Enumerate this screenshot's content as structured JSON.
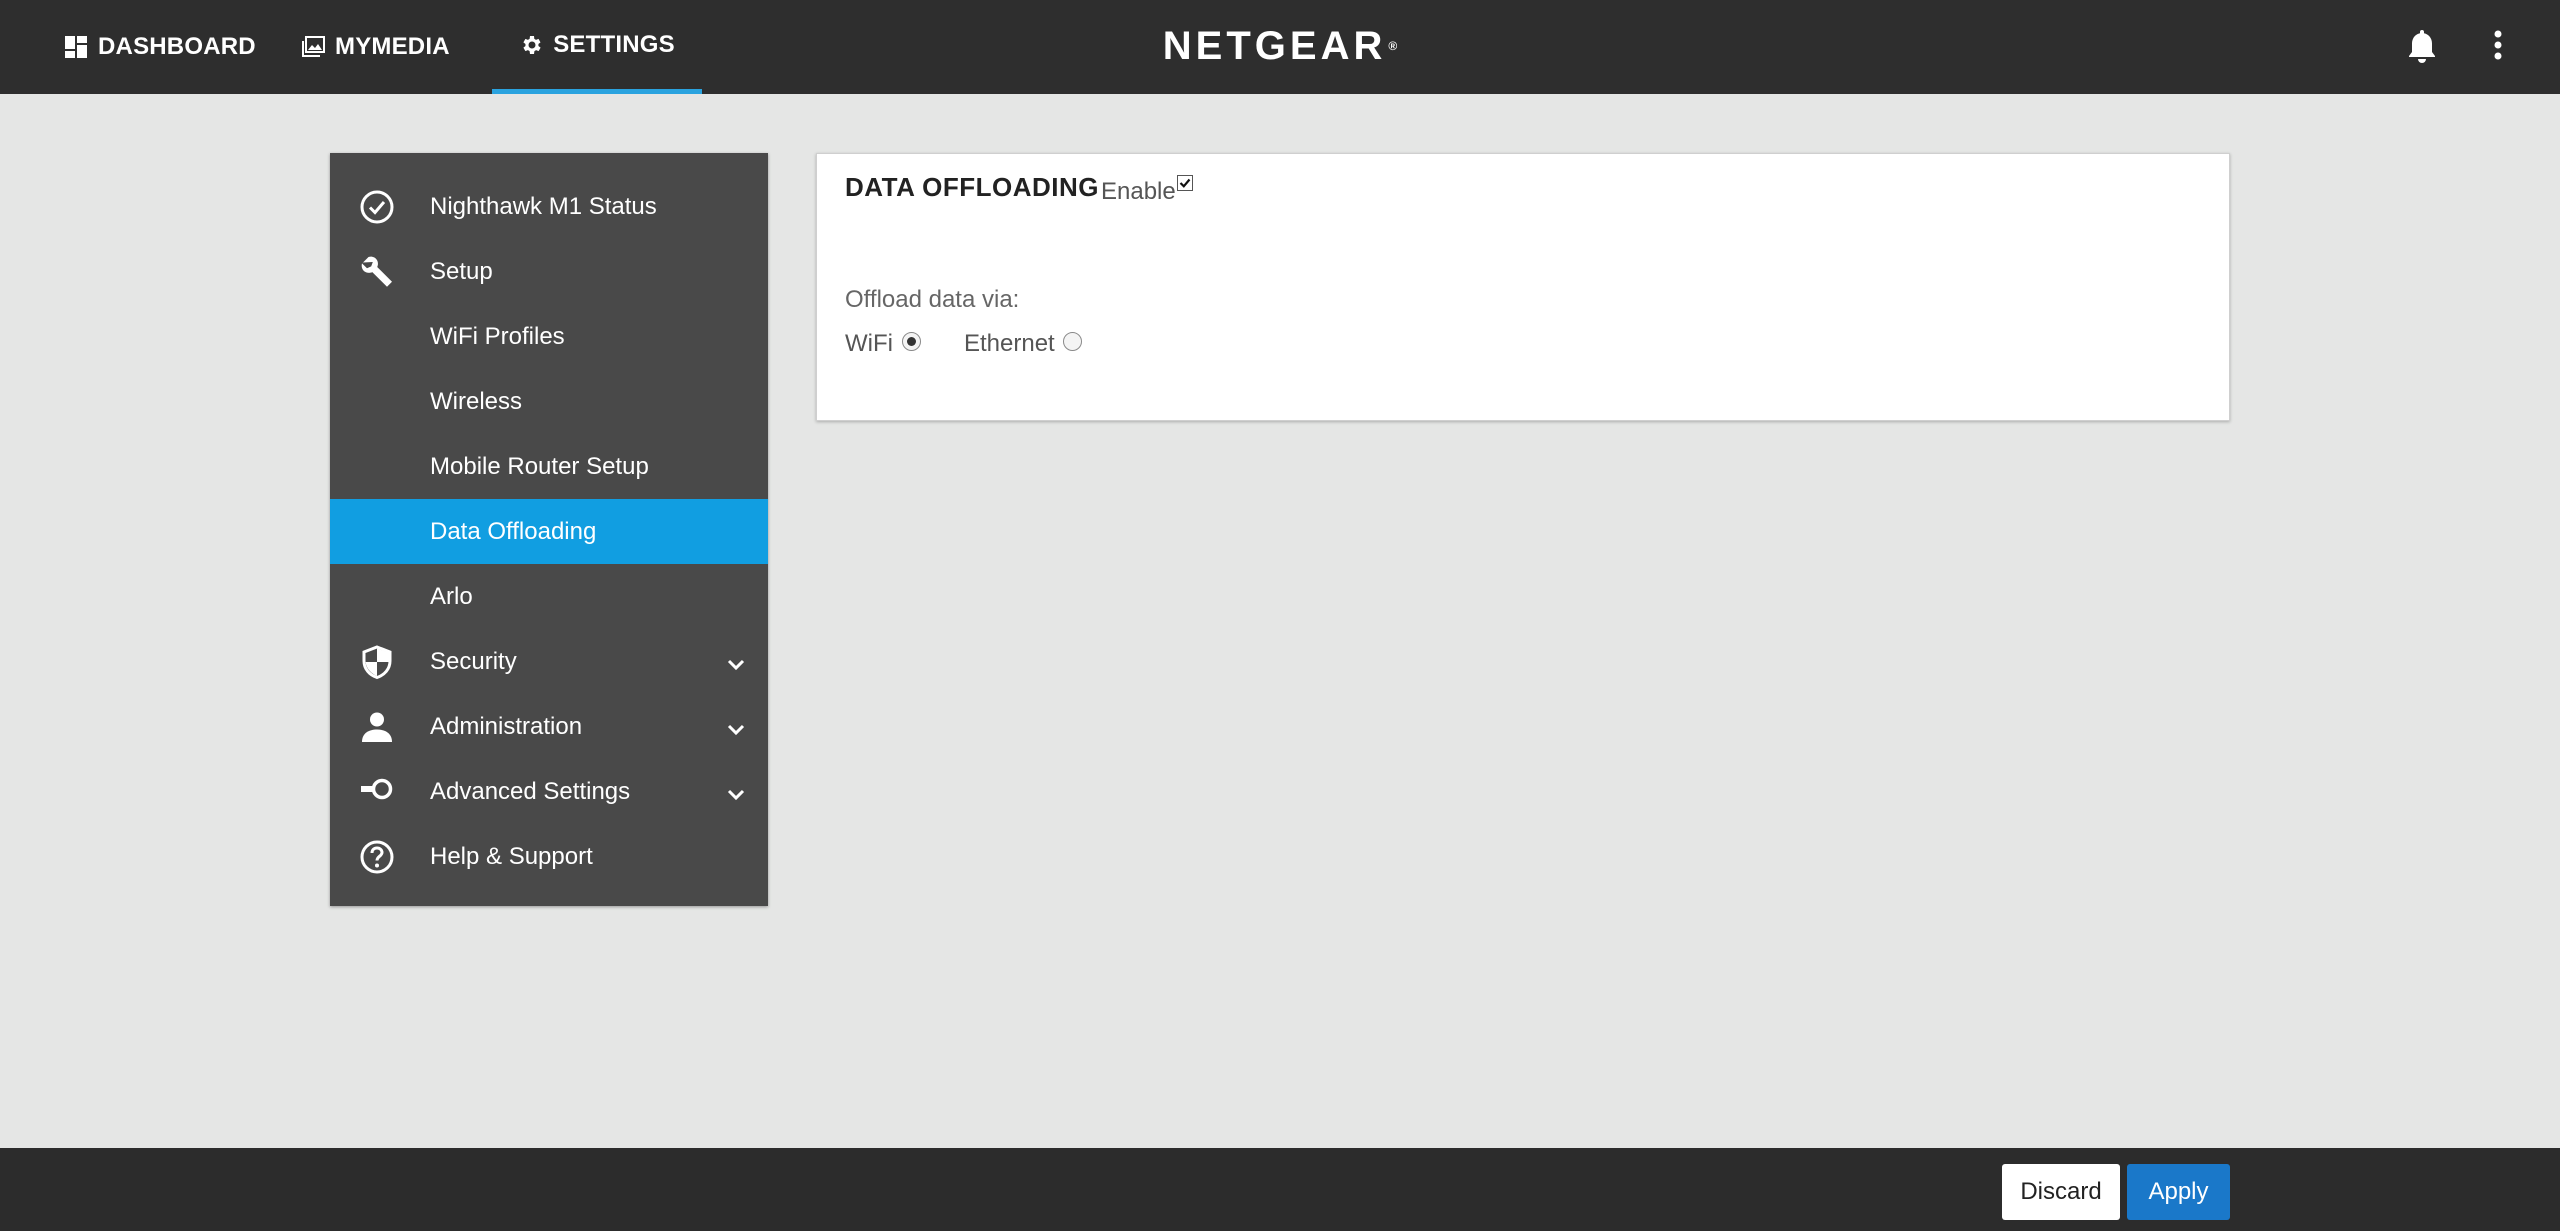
{
  "topnav": {
    "dashboard": "DASHBOARD",
    "mymedia": "MYMEDIA",
    "settings": "SETTINGS"
  },
  "brand": "NETGEAR",
  "brand_mark": "®",
  "icons": {
    "dashboard": "dashboard-grid-icon",
    "mymedia": "photo-stack-icon",
    "settings": "gear-icon",
    "notifications": "bell-icon",
    "more": "kebab-menu-icon"
  },
  "sidebar": {
    "items": [
      {
        "label": "Nighthawk M1 Status",
        "icon": "check-circle-icon"
      },
      {
        "label": "Setup",
        "icon": "wrench-icon"
      },
      {
        "label": "WiFi Profiles"
      },
      {
        "label": "Wireless"
      },
      {
        "label": "Mobile Router Setup"
      },
      {
        "label": "Data Offloading",
        "active": true
      },
      {
        "label": "Arlo"
      },
      {
        "label": "Security",
        "icon": "shield-icon",
        "expandable": true
      },
      {
        "label": "Administration",
        "icon": "person-icon",
        "expandable": true
      },
      {
        "label": "Advanced Settings",
        "icon": "toggle-key-icon",
        "expandable": true
      },
      {
        "label": "Help & Support",
        "icon": "question-circle-icon"
      }
    ]
  },
  "card": {
    "title": "DATA OFFLOADING",
    "enable_label": "Enable",
    "enable_checked": true,
    "offload_label": "Offload data via:",
    "options": [
      {
        "label": "WiFi",
        "selected": true
      },
      {
        "label": "Ethernet",
        "selected": false
      }
    ]
  },
  "actions": {
    "discard": "Discard",
    "apply": "Apply"
  },
  "colors": {
    "topbar": "#2e2e2e",
    "accent": "#2aa3df",
    "sidebar": "#494949",
    "sidebar_active": "#119ee1",
    "apply": "#1a78c9",
    "background": "#e5e6e5"
  }
}
